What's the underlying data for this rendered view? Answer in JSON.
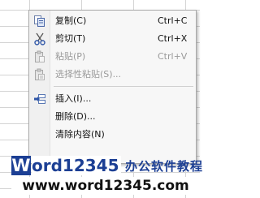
{
  "context_menu": {
    "items": [
      {
        "label": "复制(C)",
        "shortcut": "Ctrl+C",
        "icon": "copy-icon",
        "enabled": true
      },
      {
        "label": "剪切(T)",
        "shortcut": "Ctrl+X",
        "icon": "cut-icon",
        "enabled": true
      },
      {
        "label": "粘贴(P)",
        "shortcut": "Ctrl+V",
        "icon": "paste-icon",
        "enabled": false
      },
      {
        "label": "选择性粘贴(S)...",
        "shortcut": "",
        "icon": "paste-special-icon",
        "enabled": false
      },
      {
        "label": "插入(I)...",
        "shortcut": "",
        "icon": "insert-icon",
        "enabled": true
      },
      {
        "label": "删除(D)...",
        "shortcut": "",
        "icon": "",
        "enabled": true
      },
      {
        "label": "清除内容(N)",
        "shortcut": "",
        "icon": "",
        "enabled": true
      }
    ]
  },
  "watermark": {
    "logo_letter": "W",
    "logo_text": "ord12345",
    "tagline": "办公软件教程",
    "url": "www.word12345.com"
  },
  "colors": {
    "brand_blue": "#1c3f94",
    "menu_bg": "#f7f7f7",
    "disabled_text": "#9a9a9a"
  }
}
